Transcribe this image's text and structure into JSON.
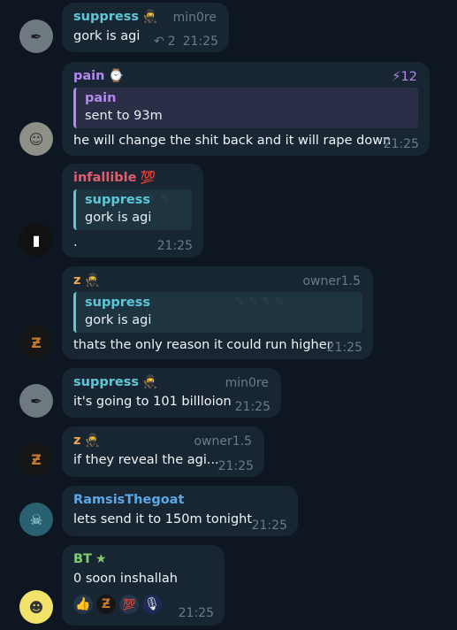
{
  "messages": [
    {
      "sender": "suppress",
      "sender_color": "#5ec8d8",
      "badge": "🥷",
      "tag": "min0re",
      "text": "gork is agi",
      "replies": "2",
      "time": "21:25"
    },
    {
      "sender": "pain",
      "sender_color": "#b388f0",
      "badge": "⌚",
      "boost": "12",
      "reply_name": "pain",
      "reply_text": "sent to 93m",
      "text": "he will change the shit back and it will rape down",
      "time": "21:25"
    },
    {
      "sender": "infallible",
      "sender_color": "#e25d6e",
      "badge": "💯",
      "reply_name": "suppress",
      "reply_text": "gork is agi",
      "text": ".",
      "time": "21:25"
    },
    {
      "sender": "z",
      "sender_color": "#f0a84a",
      "badge": "🥷",
      "tag": "owner1.5",
      "reply_name": "suppress",
      "reply_text": "gork is agi",
      "text": "thats the only reason it could run higher",
      "time": "21:25"
    },
    {
      "sender": "suppress",
      "sender_color": "#5ec8d8",
      "badge": "🥷",
      "tag": "min0re",
      "text": "it's going to 101 billloion",
      "time": "21:25"
    },
    {
      "sender": "z",
      "sender_color": "#f0a84a",
      "badge": "🥷",
      "tag": "owner1.5",
      "text": "if they reveal the agi...",
      "time": "21:25"
    },
    {
      "sender": "RamsisThegoat",
      "sender_color": "#5aa9e6",
      "text": "lets send it to 150m tonight",
      "time": "21:25"
    },
    {
      "sender": "BT",
      "sender_color": "#7fcf70",
      "badge": "★",
      "text": "0 soon inshallah",
      "time": "21:25",
      "reactions": [
        "👍",
        "Ƶ",
        "💯",
        "🎙"
      ]
    }
  ],
  "icons": {
    "reply_arrow": "reply-arrow-icon",
    "boost": "boost-bolt-icon"
  }
}
